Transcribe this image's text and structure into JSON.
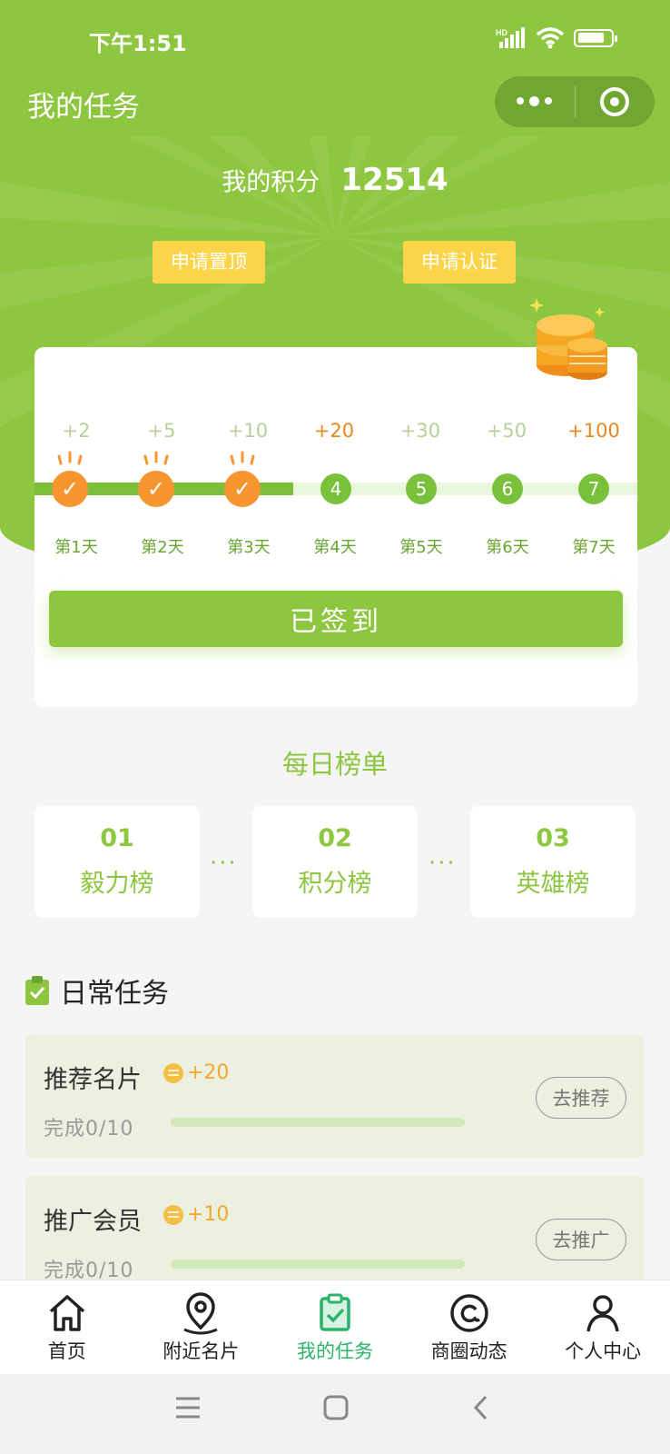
{
  "status_bar": {
    "time": "下午1:51",
    "network": "HD"
  },
  "header": {
    "title": "我的任务"
  },
  "score": {
    "label": "我的积分",
    "value": "12514"
  },
  "actions": {
    "pin": "申请置顶",
    "verify": "申请认证"
  },
  "signin": {
    "days": [
      {
        "points": "+2",
        "label": "第1天",
        "checked": true,
        "num": "1"
      },
      {
        "points": "+5",
        "label": "第2天",
        "checked": true,
        "num": "2"
      },
      {
        "points": "+10",
        "label": "第3天",
        "checked": true,
        "num": "3"
      },
      {
        "points": "+20",
        "label": "第4天",
        "checked": false,
        "num": "4"
      },
      {
        "points": "+30",
        "label": "第5天",
        "checked": false,
        "num": "5"
      },
      {
        "points": "+50",
        "label": "第6天",
        "checked": false,
        "num": "6"
      },
      {
        "points": "+100",
        "label": "第7天",
        "checked": false,
        "num": "7"
      }
    ],
    "button": "已签到"
  },
  "rankings": {
    "title": "每日榜单",
    "items": [
      {
        "num": "01",
        "name": "毅力榜"
      },
      {
        "num": "02",
        "name": "积分榜"
      },
      {
        "num": "03",
        "name": "英雄榜"
      }
    ],
    "separator": "···"
  },
  "daily_tasks": {
    "title": "日常任务",
    "items": [
      {
        "name": "推荐名片",
        "reward": "+20",
        "progress": "完成0/10",
        "button": "去推荐"
      },
      {
        "name": "推广会员",
        "reward": "+10",
        "progress": "完成0/10",
        "button": "去推广"
      }
    ]
  },
  "tabbar": {
    "items": [
      {
        "label": "首页",
        "icon": "home-icon"
      },
      {
        "label": "附近名片",
        "icon": "location-pin-icon"
      },
      {
        "label": "我的任务",
        "icon": "clipboard-check-icon"
      },
      {
        "label": "商圈动态",
        "icon": "at-circle-icon"
      },
      {
        "label": "个人中心",
        "icon": "person-icon"
      }
    ],
    "active": "我的任务"
  },
  "colors": {
    "brand": "#8dc63f",
    "accent_orange": "#f7952e",
    "yellow": "#fbd44a",
    "tab_active": "#2cb36a"
  }
}
